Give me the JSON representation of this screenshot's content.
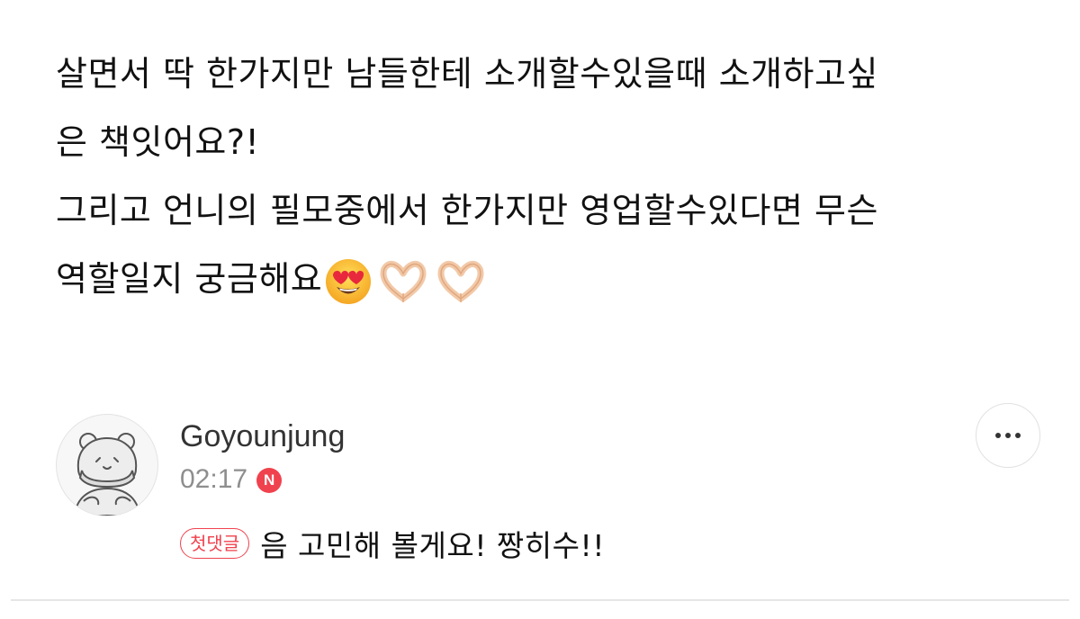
{
  "question": {
    "lines": [
      "살면서 딱 한가지만 남들한테 소개할수있을때 소개하고싶",
      "은 책잇어요?!",
      "그리고 언니의 필모중에서 한가지만 영업할수있다면 무슨",
      "역할일지 궁금해요"
    ],
    "emojis": [
      "smiling-face-with-heart-eyes",
      "heart-hands",
      "heart-hands"
    ]
  },
  "comment": {
    "author": "Goyounjung",
    "time": "02:17",
    "new_badge": "N",
    "tag": "첫댓글",
    "text": "음 고민해 볼게요! 짱히수!!",
    "more_icon": "more-horizontal-icon",
    "avatar_icon": "character-avatar"
  },
  "colors": {
    "accent": "#f0424e",
    "meta_text": "#8e8e8e",
    "divider": "#e6e6e6"
  }
}
